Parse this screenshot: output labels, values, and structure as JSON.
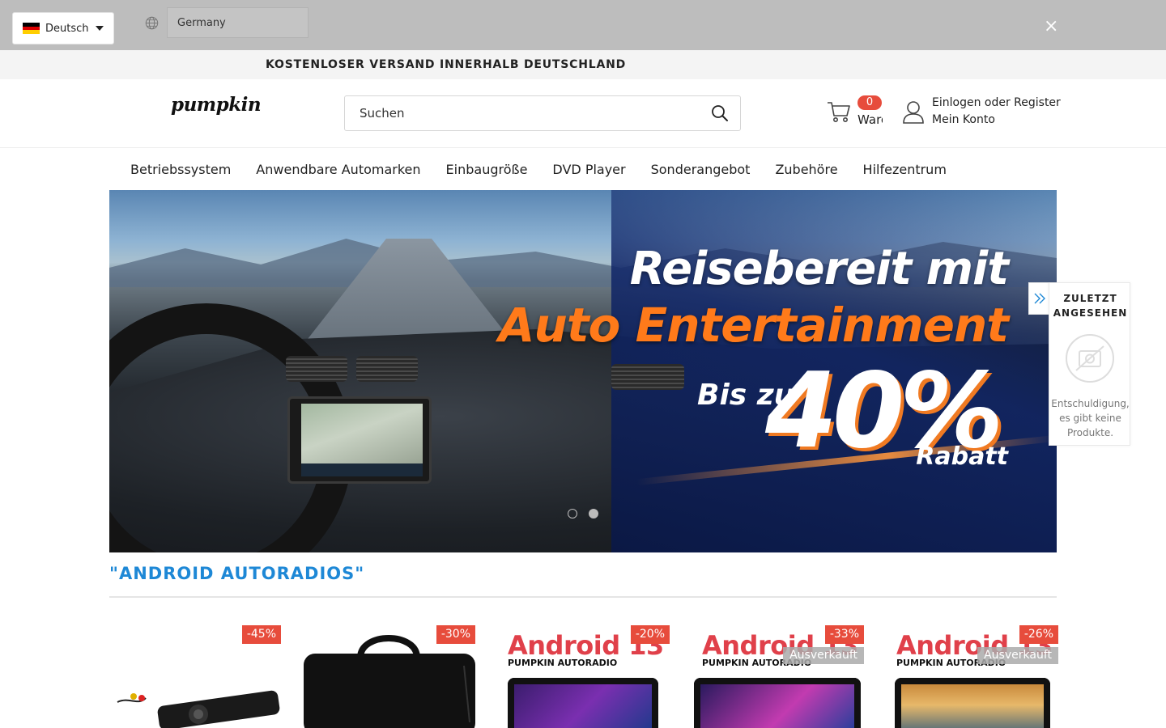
{
  "geo_bar": {
    "language_label": "Deutsch",
    "country_value": "Germany",
    "close_label": "×"
  },
  "announcement": {
    "text": "KOSTENLOSER VERSAND INNERHALB DEUTSCHLAND"
  },
  "header": {
    "logo_text": "pumpkin",
    "search_placeholder": "Suchen",
    "cart_count": "0",
    "cart_label": "Warenkorb",
    "account_line1": "Einlogen oder Register",
    "account_line2": "Mein Konto"
  },
  "nav": {
    "items": [
      "Betriebssystem",
      "Anwendbare Automarken",
      "Einbaugröße",
      "DVD Player",
      "Sonderangebot",
      "Zubehöre",
      "Hilfezentrum"
    ]
  },
  "hero": {
    "title_line1": "Reisebereit mit",
    "title_line2": "Auto Entertainment",
    "up_to": "Bis zu",
    "percent": "40%",
    "discount_word": "Rabatt",
    "slide_count": 2,
    "active_slide": 2
  },
  "recently_viewed": {
    "title": "ZULETZT ANGESEHEN",
    "empty_text": "Entschuldigung, es gibt keine Produkte."
  },
  "section": {
    "title": "\"ANDROID AUTORADIOS\""
  },
  "products": [
    {
      "discount": "-45%",
      "sold_out": ""
    },
    {
      "discount": "-30%",
      "sold_out": ""
    },
    {
      "discount": "-20%",
      "sold_out": "",
      "brand_text": "Android 13",
      "brand_sub": "PUMPKIN AUTORADIO"
    },
    {
      "discount": "-33%",
      "sold_out": "Ausverkauft",
      "brand_text": "Android 13",
      "brand_sub": "PUMPKIN AUTORADIO"
    },
    {
      "discount": "-26%",
      "sold_out": "Ausverkauft",
      "brand_text": "Android 13",
      "brand_sub": "PUMPKIN AUTORADIO"
    }
  ],
  "colors": {
    "accent_blue": "#1e88d6",
    "badge_red": "#e74c3c",
    "brand_orange": "#ff7a1a"
  }
}
